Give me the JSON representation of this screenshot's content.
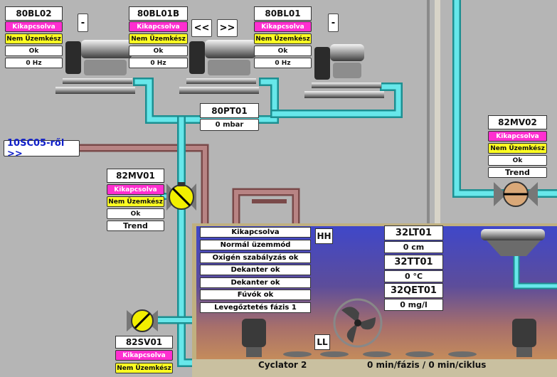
{
  "devices": {
    "blower_80bl02": {
      "name": "80BL02",
      "state": "Kikapcsolva",
      "ready": "Nem Üzemkész",
      "fault": "Ok",
      "freq": "0 Hz",
      "button": "-"
    },
    "blower_80bl01b": {
      "name": "80BL01B",
      "state": "Kikapcsolva",
      "ready": "Nem Üzemkész",
      "fault": "Ok",
      "freq": "0 Hz",
      "btn_prev": "<<",
      "btn_next": ">>"
    },
    "blower_80bl01": {
      "name": "80BL01",
      "state": "Kikapcsolva",
      "ready": "Nem Üzemkész",
      "fault": "Ok",
      "freq": "0 Hz",
      "button": "-"
    },
    "pressure_80pt01": {
      "name": "80PT01",
      "value": "0 mbar"
    },
    "valve_82mv01": {
      "name": "82MV01",
      "state": "Kikapcsolva",
      "ready": "Nem Üzemkész",
      "fault": "Ok",
      "trend": "Trend"
    },
    "valve_82mv02": {
      "name": "82MV02",
      "state": "Kikapcsolva",
      "ready": "Nem Üzemkész",
      "fault": "Ok",
      "trend": "Trend"
    },
    "valve_82sv01": {
      "name": "82SV01",
      "state": "Kikapcsolva",
      "ready": "Nem Üzemkész"
    }
  },
  "link": {
    "label": "10SC05-ről >>"
  },
  "tank": {
    "status": [
      "Kikapcsolva",
      "Normál üzemmód",
      "Oxigén szabályzás ok",
      "Dekanter ok",
      "Dekanter ok",
      "Fúvók ok",
      "Levegőztetés fázis 1"
    ],
    "hh_label": "HH",
    "ll_label": "LL",
    "level": {
      "name": "32LT01",
      "value": "0 cm"
    },
    "temp": {
      "name": "32TT01",
      "value": "0 °C"
    },
    "oxygen": {
      "name": "32QET01",
      "value": "0 mg/l"
    },
    "footer_left": "Cyclator 2",
    "footer_right": "0 min/fázis / 0 min/ciklus"
  },
  "colors": {
    "pipe_air": "#5fe3e6",
    "pipe_sludge": "#a87272",
    "tag_pink": "#ff2fd0",
    "tag_yellow": "#ffff22"
  }
}
